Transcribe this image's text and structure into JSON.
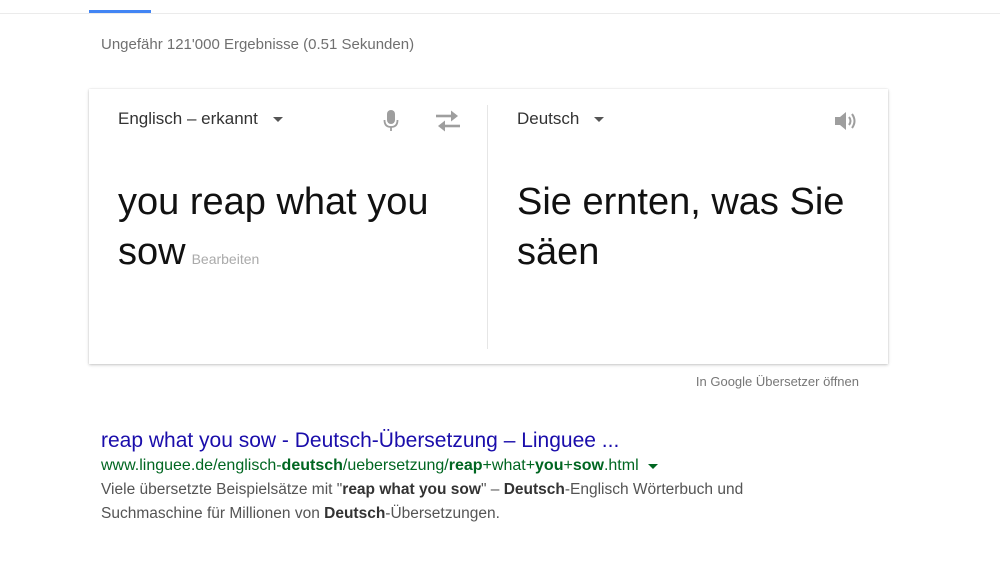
{
  "search": {
    "stats": "Ungefähr 121'000 Ergebnisse (0.51 Sekunden)"
  },
  "translate": {
    "source_language": "Englisch – erkannt",
    "target_language": "Deutsch",
    "source_text": "you reap what you sow",
    "edit_label": "Bearbeiten",
    "translated_text": "Sie ernten, was Sie säen",
    "open_link": "In Google Übersetzer öffnen",
    "icons": {
      "mic": "microphone-icon",
      "swap": "swap-icon",
      "speaker": "speaker-icon"
    },
    "colors": {
      "tab_indicator": "#4285f4",
      "icon": "#9e9e9e"
    }
  },
  "result": {
    "title": "reap what you sow - Deutsch-Übersetzung – Linguee ...",
    "url": {
      "p1": "www.linguee.de/englisch-",
      "b1": "deutsch",
      "p2": "/uebersetzung/",
      "b2": "reap",
      "p3": "+what+",
      "b3": "you",
      "p4": "+",
      "b4": "sow",
      "p5": ".html"
    },
    "snippet": {
      "s1": "Viele übersetzte Beispielsätze mit \"",
      "b1": "reap what you sow",
      "s2": "\" – ",
      "b2": "Deutsch",
      "s3": "-Englisch Wörterbuch und Suchmaschine für Millionen von ",
      "b3": "Deutsch",
      "s4": "-Übersetzungen."
    },
    "colors": {
      "title": "#1a0dab",
      "url": "#006621",
      "snippet": "#545454"
    }
  }
}
